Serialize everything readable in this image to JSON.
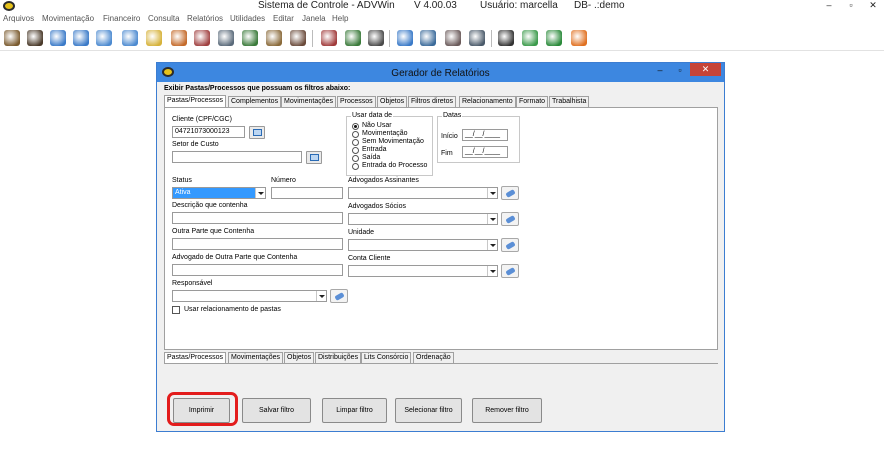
{
  "window": {
    "title": "Sistema de Controle - ADVWin",
    "version": "V 4.00.03",
    "user": "Usuário: marcella",
    "db": "DB- .:demo",
    "controls": [
      "–",
      "▫",
      "✕"
    ]
  },
  "menu": [
    "Arquivos",
    "Movimentação",
    "Financeiro",
    "Consulta",
    "Relatórios",
    "Utilidades",
    "Editar",
    "Janela",
    "Help"
  ],
  "toolbar": {
    "icons": [
      {
        "name": "clients-icon",
        "color": "#7a5a2e"
      },
      {
        "name": "person-icon",
        "color": "#4a3a2a"
      },
      {
        "name": "folder-refresh-icon",
        "color": "#3a7ac8"
      },
      {
        "name": "folder-refresh-2-icon",
        "color": "#3a7ac8"
      },
      {
        "name": "folder-open-icon",
        "color": "#4c8ad0"
      },
      {
        "name": "folder-gear-icon",
        "color": "#4c8ad0"
      },
      {
        "name": "calendar-icon",
        "color": "#d6b23a"
      },
      {
        "name": "tools-icon",
        "color": "#c46a2a"
      },
      {
        "name": "contacts-icon",
        "color": "#a04040"
      },
      {
        "name": "document-icon",
        "color": "#5a6a7a"
      },
      {
        "name": "check-icon",
        "color": "#3a7a3a"
      },
      {
        "name": "users-icon",
        "color": "#8a6a3a"
      },
      {
        "name": "group-icon",
        "color": "#6a4a3a"
      },
      {
        "name": "scales-icon",
        "color": "#a03a3a"
      },
      {
        "name": "scales-2-icon",
        "color": "#3a7a3a"
      },
      {
        "name": "camera-icon",
        "color": "#4a4a4a"
      },
      {
        "name": "clock-icon",
        "color": "#3a7ac8"
      },
      {
        "name": "folder-clock-icon",
        "color": "#3a6a9a"
      },
      {
        "name": "archive-icon",
        "color": "#6a5a5a"
      },
      {
        "name": "screen-icon",
        "color": "#4a5a6a"
      },
      {
        "name": "scissors-icon",
        "color": "#333333"
      },
      {
        "name": "recycle-icon",
        "color": "#3a9a4a"
      },
      {
        "name": "refresh-icon",
        "color": "#2a8a3a"
      },
      {
        "name": "exit-icon",
        "color": "#e07020"
      }
    ]
  },
  "dialog": {
    "title": "Gerador de Relatórios",
    "heading": "Exibir Pastas/Processos que possuam os filtros abaixo:",
    "top_tabs": [
      "Pastas/Processos",
      "Complementos",
      "Movimentações",
      "Processos",
      "Objetos",
      "Filtros diretos",
      "Relacionamento",
      "Formato",
      "Trabalhista"
    ],
    "fields": {
      "cliente_label": "Cliente (CPF/CGC)",
      "cliente_value": "04721073000123",
      "setor_label": "Setor de Custo",
      "setor_value": "",
      "status_label": "Status",
      "status_value": "Ativa",
      "numero_label": "Número",
      "descricao_label": "Descrição que contenha",
      "outra_parte_label": "Outra Parte que Contenha",
      "advogado_outra_label": "Advogado de Outra Parte que Contenha",
      "responsavel_label": "Responsável",
      "usar_relacionamento_label": "Usar relacionamento de pastas",
      "adv_assinantes_label": "Advogados Assinantes",
      "adv_socios_label": "Advogados Sócios",
      "unidade_label": "Unidade",
      "conta_cliente_label": "Conta Cliente"
    },
    "usar_data": {
      "label": "Usar data de",
      "options": [
        "Não Usar",
        "Movimentação",
        "Sem Movimentação",
        "Entrada",
        "Saída",
        "Entrada do Processo"
      ],
      "selected": "Não Usar"
    },
    "datas": {
      "label": "Datas",
      "inicio_label": "Início",
      "fim_label": "Fim",
      "inicio_value": "__/__/____",
      "fim_value": "__/__/____"
    },
    "bottom_tabs": [
      "Pastas/Processos",
      "Movimentações",
      "Objetos",
      "Distribuições",
      "Lits Consórcio",
      "Ordenação"
    ],
    "buttons": {
      "imprimir": "Imprimir",
      "salvar": "Salvar filtro",
      "limpar": "Limpar filtro",
      "selecionar": "Selecionar filtro",
      "remover": "Remover filtro"
    }
  }
}
